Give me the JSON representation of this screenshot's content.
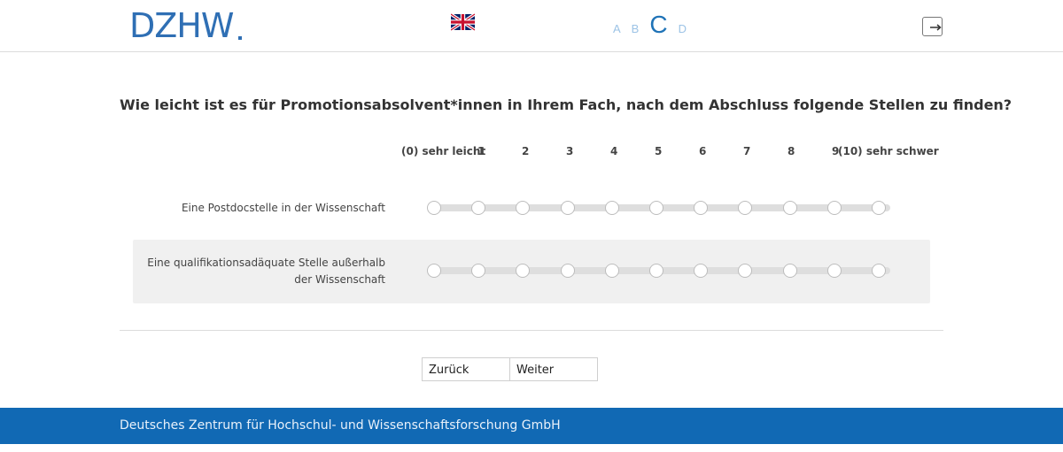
{
  "header": {
    "logo": "DZHW",
    "language_icon": "uk-flag-icon",
    "fontsize": {
      "small_a": "A",
      "small_b": "B",
      "large_c": "C",
      "small_d": "D"
    },
    "exit_icon": "logout-icon"
  },
  "question": "Wie leicht ist es für Promotionsabsolvent*innen in Ihrem Fach, nach dem Abschluss folgende Stellen zu finden?",
  "scale": {
    "labels": [
      "(0) sehr leicht",
      "1",
      "2",
      "3",
      "4",
      "5",
      "6",
      "7",
      "8",
      "9",
      "(10) sehr schwer"
    ]
  },
  "items": [
    {
      "label_line1": "Eine Postdocstelle in der Wissenschaft",
      "label_line2": ""
    },
    {
      "label_line1": "Eine qualifikationsadäquate Stelle außerhalb",
      "label_line2": "der Wissenschaft"
    }
  ],
  "nav": {
    "back": "Zurück",
    "next": "Weiter"
  },
  "footer": {
    "text": "Deutsches Zentrum für Hochschul- und Wissenschaftsforschung GmbH"
  },
  "colors": {
    "brand_blue": "#1169b4",
    "logo_blue": "#2f6fb4"
  }
}
